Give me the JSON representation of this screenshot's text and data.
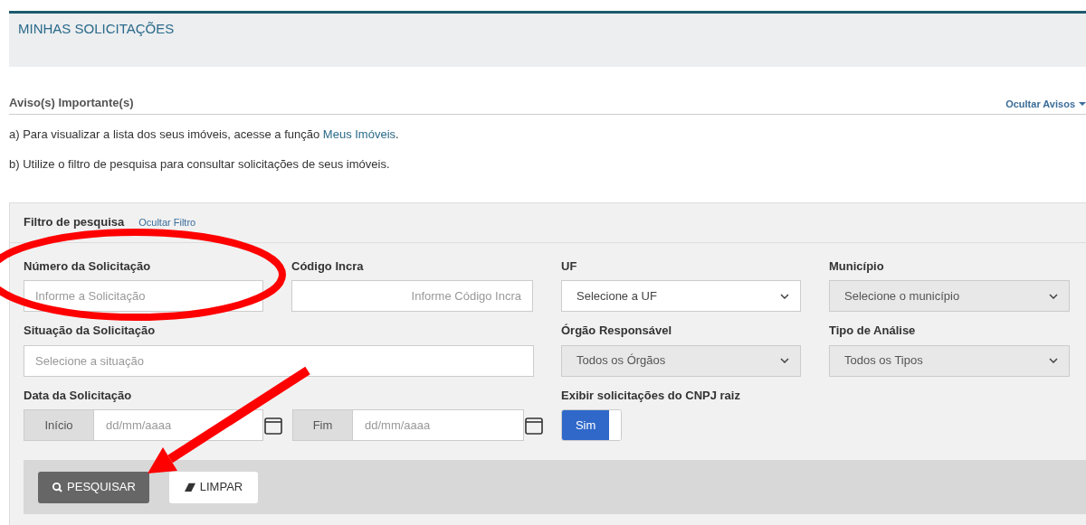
{
  "page_title": "MINHAS SOLICITAÇÕES",
  "notices": {
    "title": "Aviso(s) Importante(s)",
    "toggle": "Ocultar Avisos",
    "items": [
      {
        "text": "a) Para visualizar a lista dos seus imóveis, acesse a função ",
        "link": "Meus Imóveis",
        "after": "."
      },
      {
        "text": "b) Utilize o filtro de pesquisa para consultar solicitações de seus imóveis."
      }
    ]
  },
  "filter": {
    "title": "Filtro de pesquisa",
    "toggle": "Ocultar Filtro",
    "fields": [
      {
        "kind": "text",
        "label": "Número da Solicitação",
        "placeholder": "Informe a Solicitação"
      },
      {
        "kind": "text_right",
        "label": "Código Incra",
        "placeholder": "Informe Código Incra"
      },
      {
        "kind": "select",
        "label": "UF",
        "value": "Selecione a UF",
        "disabled": false
      },
      {
        "kind": "select",
        "label": "Município",
        "value": "Selecione o município",
        "disabled": true
      },
      {
        "kind": "wide",
        "label": "Situação da Solicitação",
        "placeholder": "Selecione a situação"
      },
      {
        "kind": "select",
        "label": "Órgão Responsável",
        "value": "Todos os Órgãos",
        "disabled": true
      },
      {
        "kind": "select",
        "label": "Tipo de Análise",
        "value": "Todos os Tipos",
        "disabled": true
      },
      {
        "kind": "daterange",
        "label": "Data da Solicitação",
        "start_label": "Início",
        "start_placeholder": "dd/mm/aaaa",
        "end_label": "Fim",
        "end_placeholder": "dd/mm/aaaa"
      },
      {
        "kind": "toggle",
        "label": "Exibir solicitações do CNPJ raiz",
        "value": "Sim",
        "on": true
      }
    ],
    "buttons": [
      {
        "kind": "search",
        "label": "PESQUISAR"
      },
      {
        "kind": "clear",
        "label": "LIMPAR"
      }
    ]
  }
}
